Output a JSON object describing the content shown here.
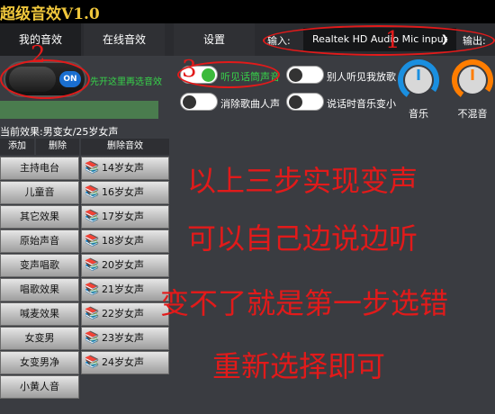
{
  "app": {
    "title": "超级音效V1.0"
  },
  "tabs": [
    {
      "label": "我的音效"
    },
    {
      "label": "在线音效"
    },
    {
      "label": "设置"
    }
  ],
  "io": {
    "input_label": "输入:",
    "device": "Realtek HD Audio Mic input",
    "output_label": "输出:"
  },
  "main_switch": {
    "state": "ON",
    "hint": "先开这里再选音效"
  },
  "switches": [
    {
      "label": "听见话筒声音",
      "on": true
    },
    {
      "label": "别人听见我放歌",
      "on": false
    },
    {
      "label": "消除歌曲人声",
      "on": false
    },
    {
      "label": "说话时音乐变小",
      "on": false
    }
  ],
  "gauges": [
    {
      "label": "音乐",
      "color": "#1a8fe0"
    },
    {
      "label": "不混音",
      "color": "#ff7d00"
    }
  ],
  "status": {
    "current_effect": "当前效果:男变女/25岁女声"
  },
  "list_actions": {
    "add": "添加",
    "delete": "删除",
    "delete_effect": "删除音效"
  },
  "left_items": [
    "主持电台",
    "儿童音",
    "其它效果",
    "原始声音",
    "变声唱歌",
    "唱歌效果",
    "喊麦效果",
    "女变男",
    "女变男净",
    "小黄人音"
  ],
  "right_items": [
    "14岁女声",
    "16岁女声",
    "17岁女声",
    "18岁女声",
    "20岁女声",
    "21岁女声",
    "22岁女声",
    "23岁女声",
    "24岁女声"
  ],
  "annotations": {
    "line1": "以上三步实现变声",
    "line2": "可以自己边说边听",
    "line3": "变不了就是第一步选错",
    "line4": "重新选择即可",
    "num1": "1",
    "num2": "2",
    "num3": "3"
  },
  "colors": {
    "annotation_red": "#e21a1a",
    "hint_green": "#37d34a",
    "title_gold": "#f0c73c",
    "accent_blue": "#1a6fd0"
  }
}
